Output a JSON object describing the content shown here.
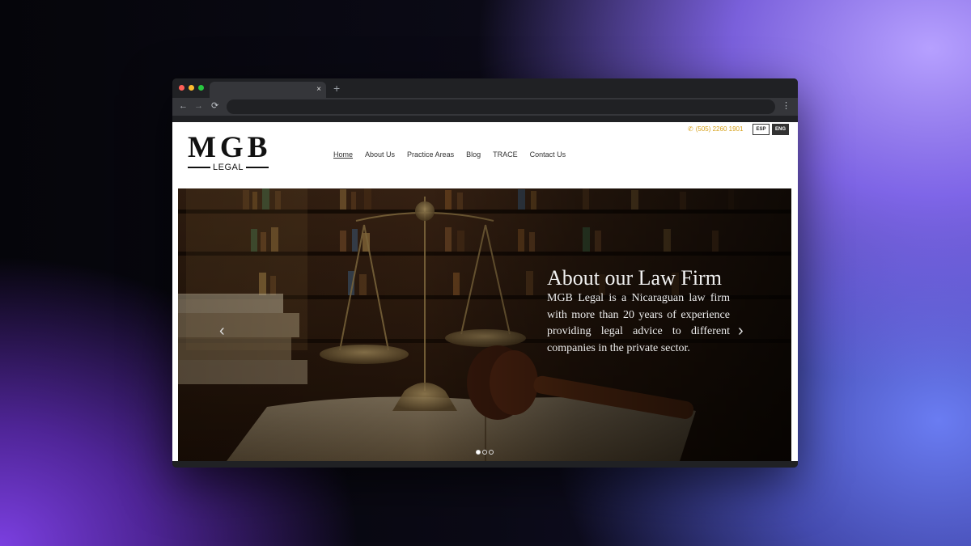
{
  "browser": {
    "tab_close": "×",
    "new_tab": "+",
    "back": "←",
    "forward": "→",
    "reload": "⟳",
    "menu": "⋮"
  },
  "header": {
    "logo_main": "MGB",
    "logo_sub": "LEGAL",
    "phone": "(505) 2260 1901",
    "lang_esp": "ESP",
    "lang_eng": "ENG"
  },
  "nav": {
    "items": [
      "Home",
      "About Us",
      "Practice Areas",
      "Blog",
      "TRACE",
      "Contact Us"
    ],
    "active": "Home"
  },
  "hero": {
    "title": "About our Law Firm",
    "text": "MGB Legal is a Nicaraguan law firm with more than 20 years of experience providing legal advice to different companies in the private sector.",
    "prev": "‹",
    "next": "›",
    "slides": 3,
    "active_slide": 1
  },
  "colors": {
    "accent": "#d7a21b",
    "chrome_dark": "#202124",
    "chrome_mid": "#35363a"
  }
}
